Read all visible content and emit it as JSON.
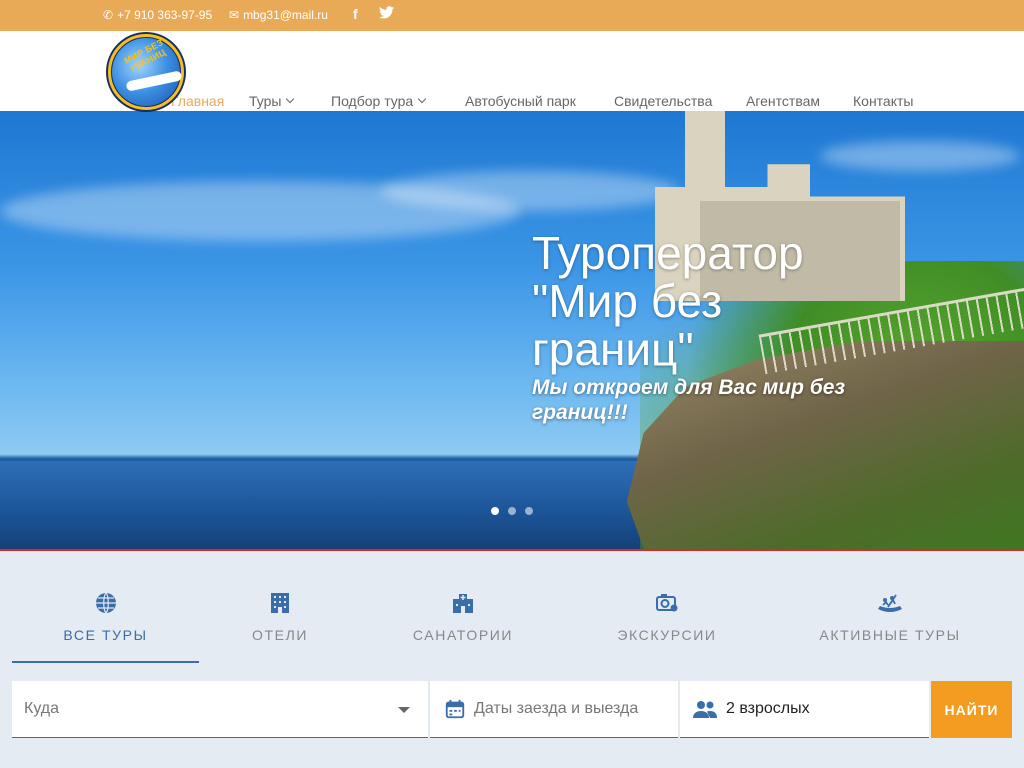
{
  "topbar": {
    "phone": "+7 910 363-97-95",
    "email": "mbg31@mail.ru",
    "social": [
      "facebook-icon",
      "twitter-icon"
    ]
  },
  "logo": {
    "text": "МИР БЕЗ ГРАНИЦ"
  },
  "nav": {
    "items": [
      {
        "label": "Главная",
        "active": true
      },
      {
        "label": "Туры",
        "dropdown": true
      },
      {
        "label": "Подбор тура",
        "dropdown": true
      },
      {
        "label": "Автобусный парк"
      },
      {
        "label": "Свидетельства"
      },
      {
        "label": "Агентствам"
      },
      {
        "label": "Контакты"
      }
    ]
  },
  "hero": {
    "title": "Туроператор \"Мир без границ\"",
    "subtitle": "Мы откроем для Вас мир без границ!!!",
    "slides": 3,
    "active_slide": 1
  },
  "search": {
    "tabs": [
      {
        "label": "Все туры",
        "icon": "globe-icon",
        "active": true
      },
      {
        "label": "Отели",
        "icon": "hotel-icon"
      },
      {
        "label": "Санатории",
        "icon": "sanatorium-icon"
      },
      {
        "label": "Экскурсии",
        "icon": "camera-icon"
      },
      {
        "label": "Активные туры",
        "icon": "rafting-icon"
      }
    ],
    "where_placeholder": "Куда",
    "dates_placeholder": "Даты заезда и выезда",
    "guests_value": "2 взрослых",
    "submit_label": "НАЙТИ"
  },
  "colors": {
    "topbar": "#e9aa57",
    "accent": "#3a6ea8",
    "button": "#f39c1f"
  }
}
